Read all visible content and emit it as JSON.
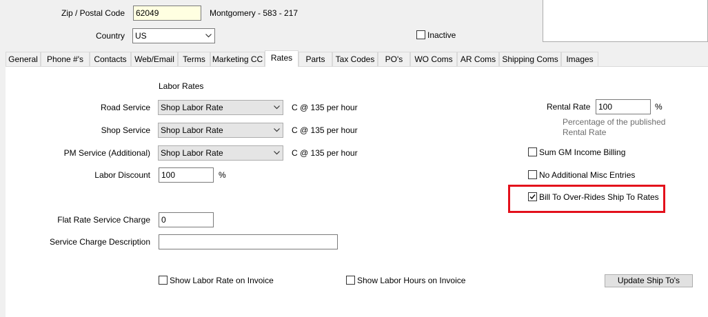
{
  "header": {
    "zip_label": "Zip / Postal Code",
    "zip_value": "62049",
    "zip_info": "Montgomery - 583 - 217",
    "country_label": "Country",
    "country_value": "US",
    "inactive_label": "Inactive",
    "inactive_checked": false
  },
  "tabs": [
    {
      "label": "General"
    },
    {
      "label": "Phone #'s"
    },
    {
      "label": "Contacts"
    },
    {
      "label": "Web/Email"
    },
    {
      "label": "Terms"
    },
    {
      "label": "Marketing CC"
    },
    {
      "label": "Rates",
      "active": true
    },
    {
      "label": "Parts"
    },
    {
      "label": "Tax Codes"
    },
    {
      "label": "PO's"
    },
    {
      "label": "WO Coms"
    },
    {
      "label": "AR Coms"
    },
    {
      "label": "Shipping Coms"
    },
    {
      "label": "Images"
    }
  ],
  "rates": {
    "section_title": "Labor Rates",
    "road_service_label": "Road Service",
    "road_service_value": "Shop Labor Rate",
    "road_service_info": "C @ 135 per hour",
    "shop_service_label": "Shop Service",
    "shop_service_value": "Shop Labor Rate",
    "shop_service_info": "C @ 135 per hour",
    "pm_service_label": "PM Service (Additional)",
    "pm_service_value": "Shop Labor Rate",
    "pm_service_info": "C @ 135 per hour",
    "labor_discount_label": "Labor Discount",
    "labor_discount_value": "100",
    "percent_symbol": "%",
    "flat_rate_label": "Flat Rate Service Charge",
    "flat_rate_value": "0",
    "service_desc_label": "Service Charge Description",
    "service_desc_value": "",
    "show_labor_rate_label": "Show Labor Rate on Invoice",
    "show_labor_rate_checked": false,
    "show_labor_hours_label": "Show Labor Hours on Invoice",
    "show_labor_hours_checked": false,
    "update_button": "Update Ship To's"
  },
  "rental": {
    "rental_rate_label": "Rental Rate",
    "rental_rate_value": "100",
    "percent_symbol": "%",
    "note_line1": "Percentage of the published",
    "note_line2": "Rental Rate",
    "sum_gm_label": "Sum GM Income Billing",
    "sum_gm_checked": false,
    "no_misc_label": "No Additional Misc Entries",
    "no_misc_checked": false,
    "bill_to_label": "Bill To Over-Rides Ship To Rates",
    "bill_to_checked": true
  },
  "colors": {
    "highlight": "#e3101b",
    "zip_field_bg": "#ffffe1"
  }
}
